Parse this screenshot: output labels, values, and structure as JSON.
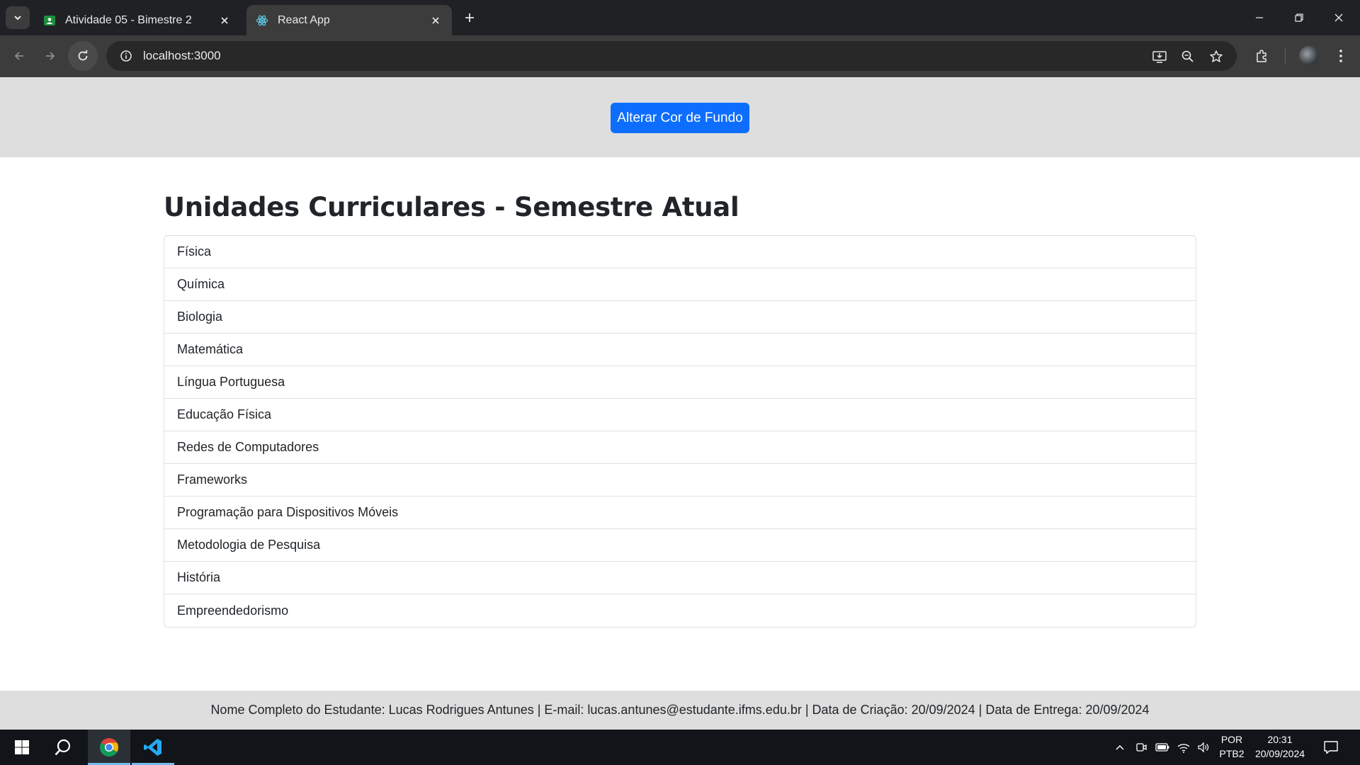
{
  "browser": {
    "tabs": [
      {
        "title": "Atividade 05 - Bimestre 2",
        "icon": "classroom-icon",
        "active": false
      },
      {
        "title": "React App",
        "icon": "react-icon",
        "active": true
      }
    ],
    "url": "localhost:3000"
  },
  "page": {
    "button_label": "Alterar Cor de Fundo",
    "title": "Unidades Curriculares - Semestre Atual",
    "subjects": [
      "Física",
      "Química",
      "Biologia",
      "Matemática",
      "Língua Portuguesa",
      "Educação Física",
      "Redes de Computadores",
      "Frameworks",
      "Programação para Dispositivos Móveis",
      "Metodologia de Pesquisa",
      "História",
      "Empreendedorismo"
    ],
    "footer": "Nome Completo do Estudante: Lucas Rodrigues Antunes | E-mail: lucas.antunes@estudante.ifms.edu.br | Data de Criação: 20/09/2024 | Data de Entrega: 20/09/2024",
    "colors": {
      "header_bg": "#dedede",
      "button_bg": "#0d6efd",
      "footer_bg": "#dedede"
    }
  },
  "taskbar": {
    "language_top": "POR",
    "language_bottom": "PTB2",
    "time": "20:31",
    "date": "20/09/2024"
  }
}
